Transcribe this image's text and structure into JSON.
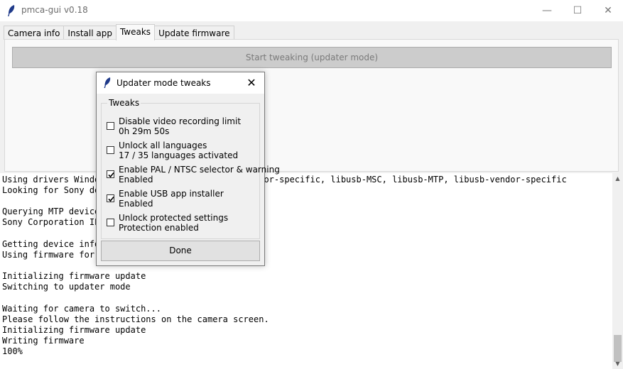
{
  "window": {
    "title": "pmca-gui v0.18"
  },
  "tabs": [
    {
      "label": "Camera info"
    },
    {
      "label": "Install app"
    },
    {
      "label": "Tweaks"
    },
    {
      "label": "Update firmware"
    }
  ],
  "main": {
    "start_button": "Start tweaking (updater mode)"
  },
  "log": {
    "lines": [
      "Using drivers Windows-MSC, Windows-MTP, libusb-vendor-specific, libusb-MSC, libusb-MTP, libusb-vendor-specific",
      "Looking for Sony devices",
      "",
      "Querying MTP device",
      "Sony Corporation ILCE-7M2 (MTP mode)",
      "",
      "Getting device info",
      "Using firmware for model ILCE-7M2",
      "",
      "Initializing firmware update",
      "Switching to updater mode",
      "",
      "Waiting for camera to switch...",
      "Please follow the instructions on the camera screen.",
      "Initializing firmware update",
      "Writing firmware",
      "100%"
    ]
  },
  "dialog": {
    "title": "Updater mode tweaks",
    "group_label": "Tweaks",
    "options": [
      {
        "label": "Disable video recording limit",
        "status": "0h 29m 50s",
        "checked": false
      },
      {
        "label": "Unlock all languages",
        "status": "17 / 35 languages activated",
        "checked": false
      },
      {
        "label": "Enable PAL / NTSC selector & warning",
        "status": "Enabled",
        "checked": true
      },
      {
        "label": "Enable USB app installer",
        "status": "Enabled",
        "checked": true
      },
      {
        "label": "Unlock protected settings",
        "status": "Protection enabled",
        "checked": false
      }
    ],
    "done_button": "Done"
  }
}
